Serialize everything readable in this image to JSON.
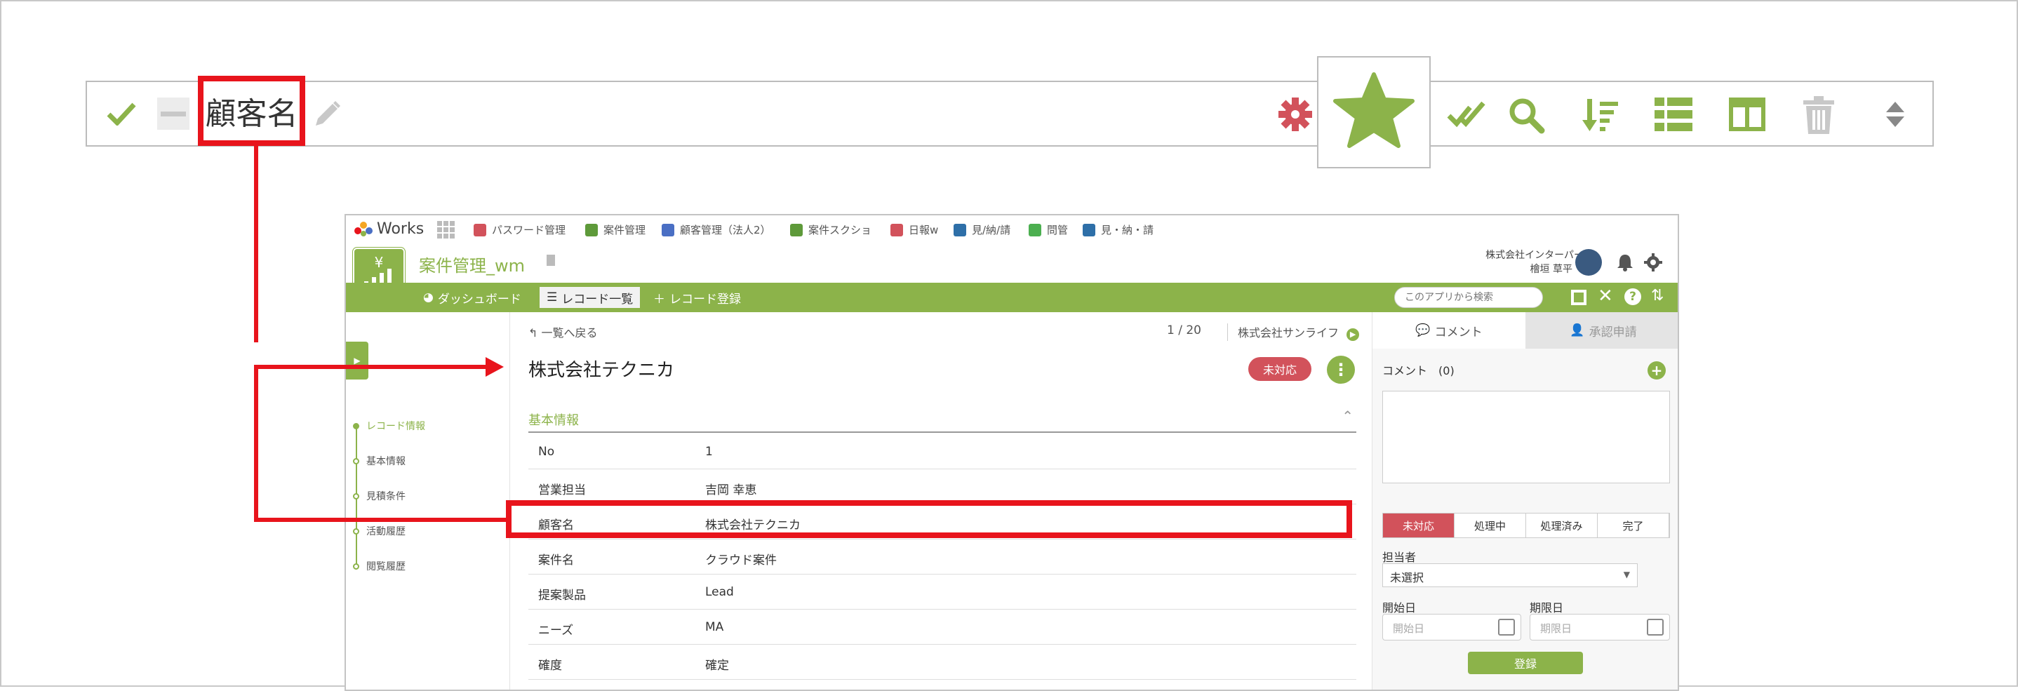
{
  "toolbar": {
    "field_label": "顧客名",
    "icons": [
      "check-icon",
      "minus-icon",
      "pencil-icon",
      "gear-icon",
      "star-icon",
      "double-check-icon",
      "search-icon",
      "sort-icon",
      "list-icon",
      "columns-icon",
      "trash-icon",
      "sort-arrows-icon"
    ],
    "colors": {
      "accent": "#8cb34a",
      "danger": "#d2525b",
      "gray": "#c8c8c8",
      "highlight": "#e8141c"
    }
  },
  "app": {
    "logo_text": "Works",
    "tabs": [
      {
        "label": "パスワード管理",
        "color": "#d2525b"
      },
      {
        "label": "案件管理",
        "color": "#5e9a3a"
      },
      {
        "label": "顧客管理（法人2）",
        "color": "#4a6fc4"
      },
      {
        "label": "案件スクショ",
        "color": "#5e9a3a"
      },
      {
        "label": "日報w",
        "color": "#d2525b"
      },
      {
        "label": "見/納/請",
        "color": "#2e6fa8"
      },
      {
        "label": "問管",
        "color": "#4caf50"
      },
      {
        "label": "見・納・請",
        "color": "#2e6fa8"
      }
    ],
    "app_title": "案件管理_wm",
    "company": "株式会社インターパーク",
    "user": "檜垣 草平",
    "nav": {
      "dashboard": "ダッシュボード",
      "record_list": "レコード一覧",
      "record_register": "レコード登録",
      "search_placeholder": "このアプリから検索"
    },
    "record": {
      "back": "一覧へ戻る",
      "pager": "1 / 20",
      "next": "株式会社サンライフ",
      "title": "株式会社テクニカ",
      "status": "未対応",
      "section": "基本情報",
      "fields": [
        {
          "label": "No",
          "value": "1"
        },
        {
          "label": "営業担当",
          "value": "吉岡 幸恵"
        },
        {
          "label": "顧客名",
          "value": "株式会社テクニカ"
        },
        {
          "label": "案件名",
          "value": "クラウド案件"
        },
        {
          "label": "提案製品",
          "value": "Lead"
        },
        {
          "label": "ニーズ",
          "value": "MA"
        },
        {
          "label": "確度",
          "value": "確定"
        }
      ]
    },
    "sidebar_steps": [
      {
        "label": "レコード情報",
        "active": true
      },
      {
        "label": "基本情報",
        "active": false
      },
      {
        "label": "見積条件",
        "active": false
      },
      {
        "label": "活動履歴",
        "active": false
      },
      {
        "label": "閲覧履歴",
        "active": false
      }
    ],
    "right_panel": {
      "tab_comment": "コメント",
      "tab_approval": "承認申請",
      "comment_label": "コメント",
      "comment_count": "(0)",
      "statuses": [
        "未対応",
        "処理中",
        "処理済み",
        "完了"
      ],
      "assignee_label": "担当者",
      "assignee_value": "未選択",
      "start_label": "開始日",
      "start_placeholder": "開始日",
      "due_label": "期限日",
      "due_placeholder": "期限日",
      "register": "登録"
    }
  }
}
